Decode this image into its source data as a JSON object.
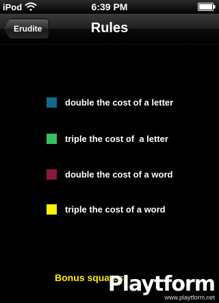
{
  "status_bar": {
    "carrier": "iPod",
    "time": "6:39 PM",
    "wifi_icon": "wifi-icon",
    "battery_icon": "battery-icon"
  },
  "nav": {
    "back_label": "Erudite",
    "title": "Rules"
  },
  "legend": [
    {
      "color": "#0f6a8c",
      "label": "double the cost of a letter"
    },
    {
      "color": "#36c160",
      "label": "triple the cost of  a letter"
    },
    {
      "color": "#8c1646",
      "label": "double the cost of a word"
    },
    {
      "color": "#fff200",
      "label": "triple the cost of a word"
    }
  ],
  "bonus_title": "Bonus squares",
  "watermark": {
    "logo": "Playtform",
    "url": "www.playtform.net"
  }
}
